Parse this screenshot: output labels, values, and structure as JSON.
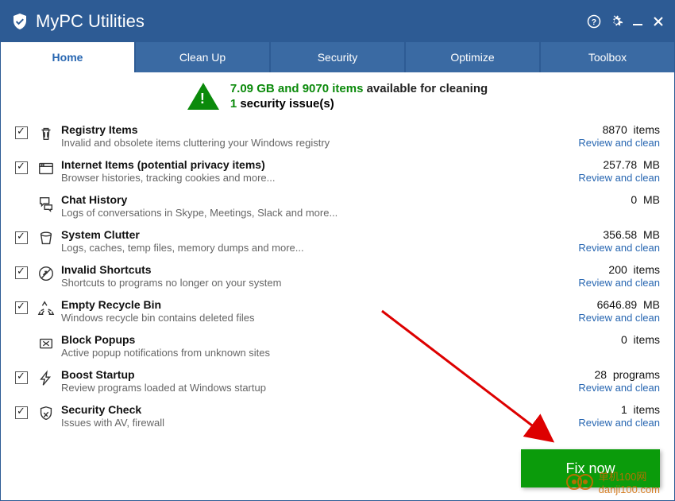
{
  "app": {
    "title": "MyPC Utilities"
  },
  "tabs": [
    "Home",
    "Clean Up",
    "Security",
    "Optimize",
    "Toolbox"
  ],
  "active_tab": 0,
  "summary": {
    "stats": "7.09 GB and 9070 items",
    "stats_suffix": " available for cleaning",
    "issues_count": "1",
    "issues_suffix": " security issue(s)"
  },
  "review_label": "Review and clean",
  "items": [
    {
      "checked": true,
      "icon": "trash",
      "title": "Registry Items",
      "desc": "Invalid and obsolete items cluttering your Windows registry",
      "value": "8870",
      "unit": "items",
      "review": true
    },
    {
      "checked": true,
      "icon": "browser",
      "title": "Internet Items (potential privacy items)",
      "desc": "Browser histories, tracking cookies and more...",
      "value": "257.78",
      "unit": "MB",
      "review": true
    },
    {
      "checked": null,
      "icon": "chat",
      "title": "Chat History",
      "desc": "Logs of conversations in Skype, Meetings, Slack and more...",
      "value": "0",
      "unit": "MB",
      "review": false
    },
    {
      "checked": true,
      "icon": "bucket",
      "title": "System Clutter",
      "desc": "Logs, caches, temp files, memory dumps and more...",
      "value": "356.58",
      "unit": "MB",
      "review": true
    },
    {
      "checked": true,
      "icon": "shortcut",
      "title": "Invalid Shortcuts",
      "desc": "Shortcuts to programs no longer on your system",
      "value": "200",
      "unit": "items",
      "review": true
    },
    {
      "checked": true,
      "icon": "recycle",
      "title": "Empty Recycle Bin",
      "desc": "Windows recycle bin contains deleted files",
      "value": "6646.89",
      "unit": "MB",
      "review": true
    },
    {
      "checked": null,
      "icon": "popup",
      "title": "Block Popups",
      "desc": "Active popup notifications from unknown sites",
      "value": "0",
      "unit": "items",
      "review": false
    },
    {
      "checked": true,
      "icon": "bolt",
      "title": "Boost Startup",
      "desc": "Review programs loaded at Windows startup",
      "value": "28",
      "unit": "programs",
      "review": true
    },
    {
      "checked": true,
      "icon": "shield",
      "title": "Security Check",
      "desc": "Issues with AV, firewall",
      "value": "1",
      "unit": "items",
      "review": true
    }
  ],
  "fix_button": "Fix now",
  "watermark": "单机100网\ndanji100.com"
}
